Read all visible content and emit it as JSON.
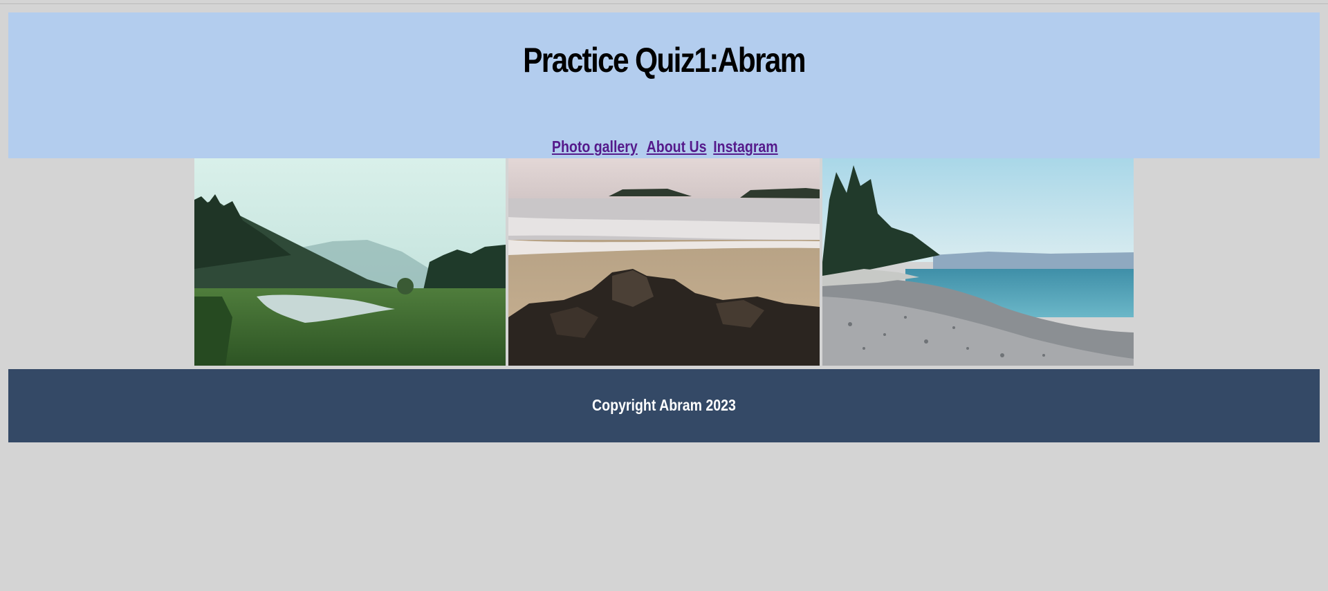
{
  "header": {
    "title": "Practice Quiz1:Abram",
    "nav": [
      {
        "label": "Photo gallery"
      },
      {
        "label": "About Us"
      },
      {
        "label": "Instagram"
      }
    ]
  },
  "gallery": [
    {
      "name": "estuary-forest-photo"
    },
    {
      "name": "sandy-beach-rocks-photo"
    },
    {
      "name": "pebble-shoreline-photo"
    }
  ],
  "footer": {
    "copyright": "Copyright Abram 2023"
  },
  "colors": {
    "page_bg": "#d4d4d4",
    "header_bg": "#b3cdee",
    "footer_bg": "#344966",
    "link": "#551a8b"
  }
}
